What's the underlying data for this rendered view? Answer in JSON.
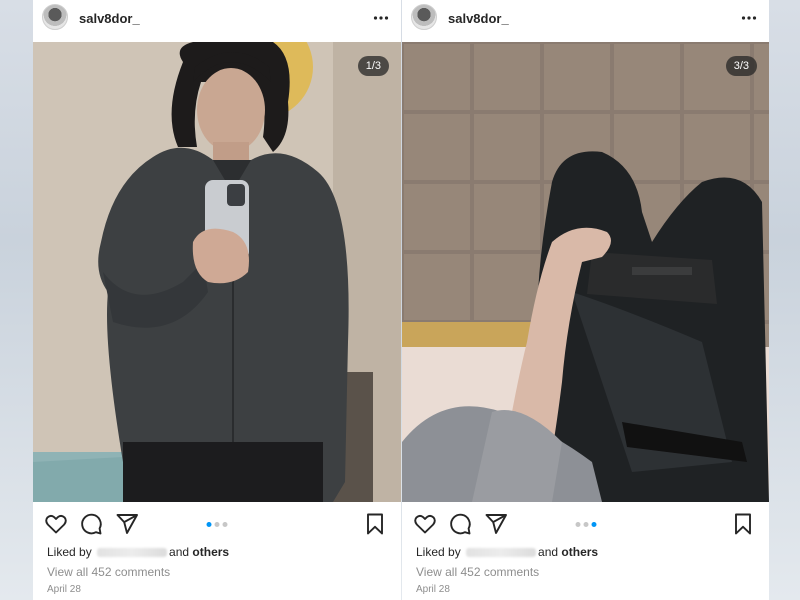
{
  "posts": [
    {
      "username": "salv8dor_",
      "counter": "1/3",
      "active_dot": 0,
      "liked_prefix": "Liked by",
      "liked_and": "and",
      "liked_others": "others",
      "comments": "View all 452 comments",
      "date": "April 28"
    },
    {
      "username": "salv8dor_",
      "counter": "3/3",
      "active_dot": 2,
      "liked_prefix": "Liked by",
      "liked_and": "and",
      "liked_others": "others",
      "comments": "View all 452 comments",
      "date": "April 28"
    }
  ],
  "icons": [
    "more-options-icon",
    "heart-icon",
    "comment-icon",
    "share-icon",
    "bookmark-icon"
  ],
  "colors": {
    "accent": "#0095f6",
    "text": "#262626",
    "muted": "#8e8e8e"
  }
}
